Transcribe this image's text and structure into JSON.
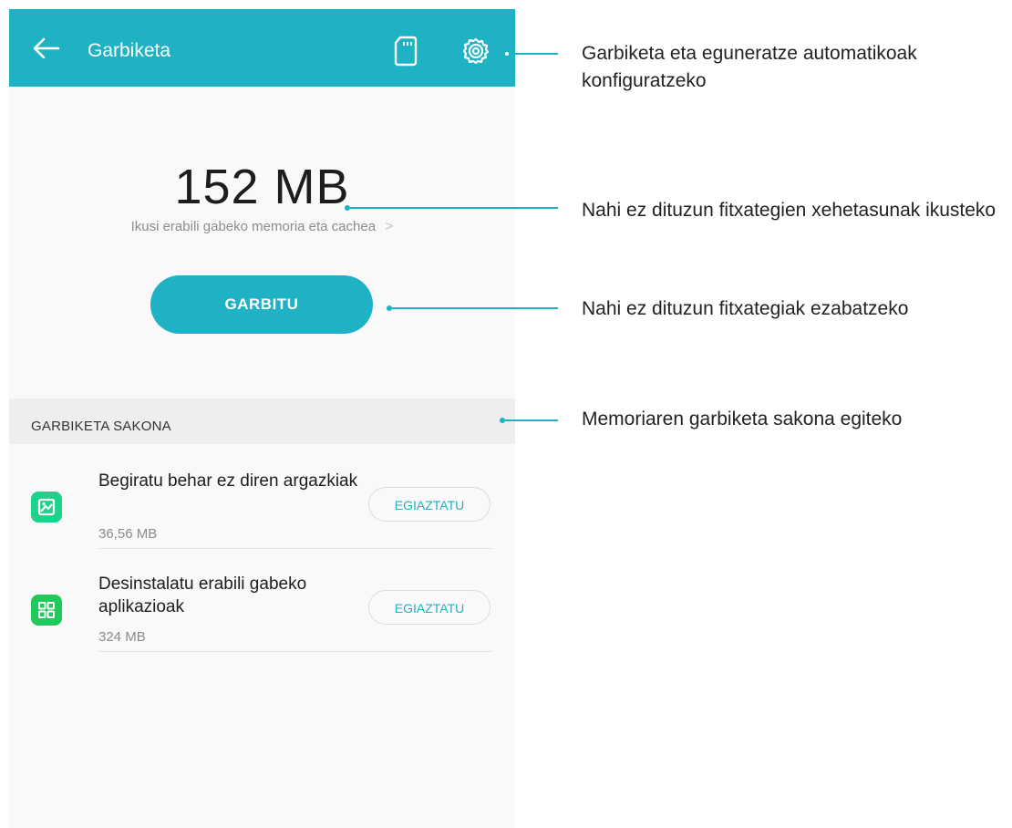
{
  "header": {
    "title": "Garbiketa",
    "back_icon": "arrow-left-icon",
    "sd_icon": "sd-card-icon",
    "settings_icon": "gear-icon",
    "color": "#1fb1c4"
  },
  "summary": {
    "size": "152 MB",
    "details_link": "Ikusi erabili gabeko memoria eta cachea"
  },
  "clean_button": {
    "label": "GARBITU"
  },
  "deep_clean": {
    "title": "GARBIKETA SAKONA",
    "items": [
      {
        "title": "Begiratu behar ez diren argazkiak",
        "size": "36,56 MB",
        "button": "EGIAZTATU",
        "icon": "image-icon",
        "icon_color": "#1dd38b"
      },
      {
        "title": "Desinstalatu erabili gabeko aplikazioak",
        "size": "324 MB",
        "button": "EGIAZTATU",
        "icon": "apps-grid-icon",
        "icon_color": "#20c95a"
      }
    ]
  },
  "callouts": [
    "Garbiketa eta eguneratze automatikoak konfiguratzeko",
    "Nahi ez dituzun fitxategien xehetasunak ikusteko",
    "Nahi ez dituzun fitxategiak ezabatzeko",
    "Memoriaren garbiketa sakona egiteko"
  ]
}
